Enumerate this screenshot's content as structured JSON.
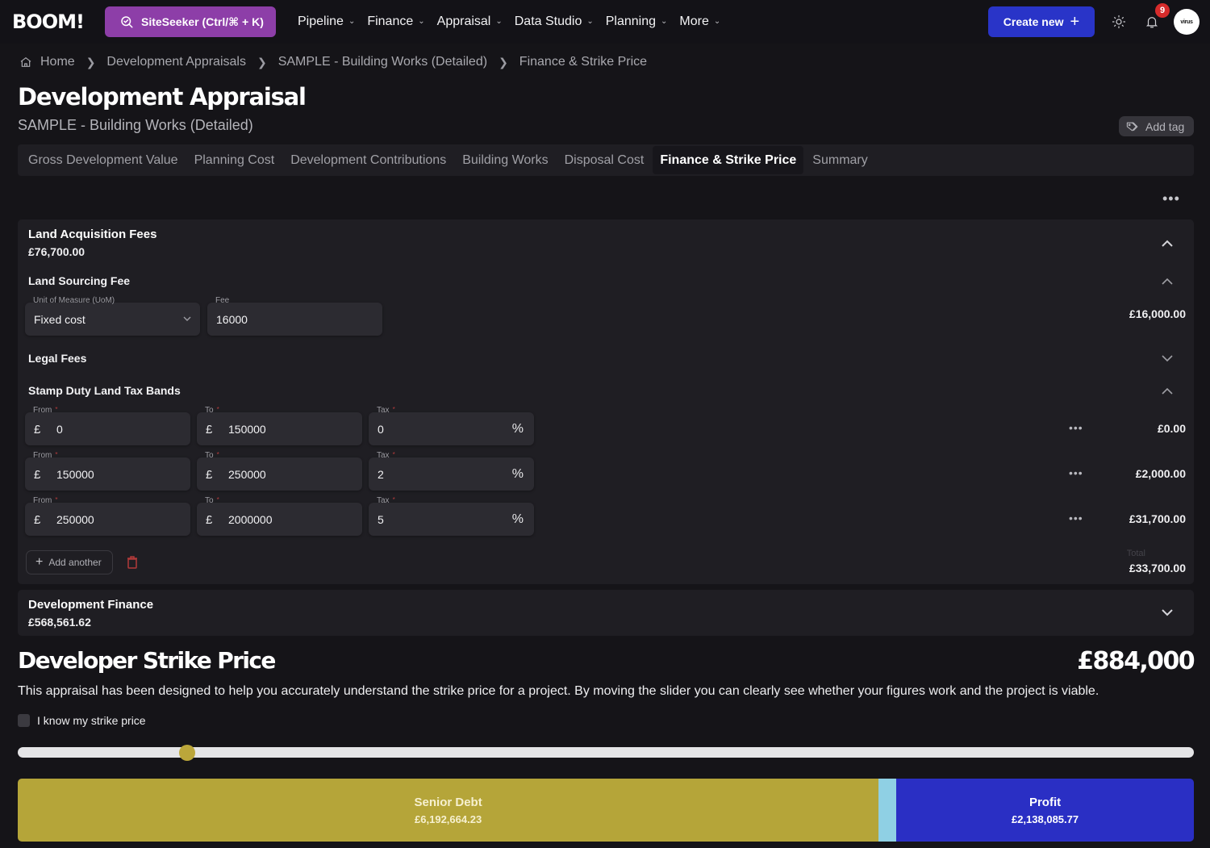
{
  "app": {
    "logo": "BOOM!",
    "siteseeker_label": "SiteSeeker (Ctrl/⌘ + K)",
    "nav": [
      {
        "label": "Pipeline"
      },
      {
        "label": "Finance"
      },
      {
        "label": "Appraisal"
      },
      {
        "label": "Data Studio"
      },
      {
        "label": "Planning"
      },
      {
        "label": "More"
      }
    ],
    "create_label": "Create new",
    "notifications_count": "9",
    "avatar_text": "virus"
  },
  "breadcrumb": [
    "Home",
    "Development Appraisals",
    "SAMPLE - Building Works (Detailed)",
    "Finance & Strike Price"
  ],
  "header": {
    "title": "Development Appraisal",
    "subtitle": "SAMPLE - Building Works (Detailed)",
    "add_tag_label": "Add tag"
  },
  "tabs": [
    {
      "label": "Gross Development Value",
      "active": false
    },
    {
      "label": "Planning Cost",
      "active": false
    },
    {
      "label": "Development Contributions",
      "active": false
    },
    {
      "label": "Building Works",
      "active": false
    },
    {
      "label": "Disposal Cost",
      "active": false
    },
    {
      "label": "Finance & Strike Price",
      "active": true
    },
    {
      "label": "Summary",
      "active": false
    }
  ],
  "land_acquisition": {
    "title": "Land Acquisition Fees",
    "amount": "£76,700.00",
    "land_sourcing": {
      "title": "Land Sourcing Fee",
      "uom_label": "Unit of Measure (UoM)",
      "uom_value": "Fixed cost",
      "fee_label": "Fee",
      "fee_value": "16000",
      "amount": "£16,000.00"
    },
    "legal_fees": {
      "title": "Legal Fees"
    },
    "sdlt": {
      "title": "Stamp Duty Land Tax Bands",
      "from_label": "From",
      "to_label": "To",
      "tax_label": "Tax",
      "currency": "£",
      "percent": "%",
      "bands": [
        {
          "from": "0",
          "to": "150000",
          "tax": "0",
          "amount": "£0.00"
        },
        {
          "from": "150000",
          "to": "250000",
          "tax": "2",
          "amount": "£2,000.00"
        },
        {
          "from": "250000",
          "to": "2000000",
          "tax": "5",
          "amount": "£31,700.00"
        }
      ],
      "add_another_label": "Add another",
      "total_label": "Total",
      "total": "£33,700.00"
    }
  },
  "development_finance": {
    "title": "Development Finance",
    "amount": "£568,561.62"
  },
  "strike": {
    "title": "Developer Strike Price",
    "price": "£884,000",
    "description": "This appraisal has been designed to help you accurately understand the strike price for a project. By moving the slider you can clearly see whether your figures work and the project is viable.",
    "checkbox_label": "I know my strike price",
    "checkbox_checked": false,
    "slider_fraction": 0.144
  },
  "funding_stack": [
    {
      "key": "senior",
      "label": "Senior Debt",
      "value": "£6,192,664.23",
      "share": 0.732,
      "color": "#b5a539"
    },
    {
      "key": "gap",
      "label": "",
      "value": "",
      "share": 0.015,
      "color": "#8fd0e4"
    },
    {
      "key": "profit",
      "label": "Profit",
      "value": "£2,138,085.77",
      "share": 0.253,
      "color": "#2a2fc4"
    }
  ]
}
